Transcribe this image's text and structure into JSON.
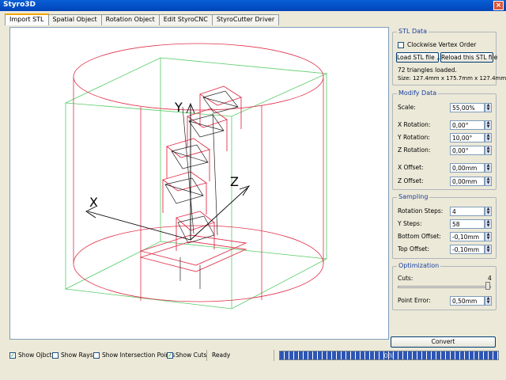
{
  "window": {
    "title": "Styro3D",
    "close_glyph": "×"
  },
  "tabs": [
    {
      "label": "Import STL",
      "active": true
    },
    {
      "label": "Spatial Object",
      "active": false
    },
    {
      "label": "Rotation Object",
      "active": false
    },
    {
      "label": "Edit StyroCNC",
      "active": false
    },
    {
      "label": "StyroCutter Driver",
      "active": false
    }
  ],
  "stl_data": {
    "title": "STL Data",
    "clockwise_label": "Clockwise Vertex Order",
    "clockwise_checked": false,
    "load_button": "Load STL file ...",
    "reload_button": "Reload this STL file",
    "triangles_text": "72 triangles loaded.",
    "size_text": "Size: 127.4mm x 175.7mm x 127.4mm"
  },
  "modify_data": {
    "title": "Modify Data",
    "scale_label": "Scale:",
    "scale_value": "55,00%",
    "xrot_label": "X Rotation:",
    "xrot_value": "0,00°",
    "yrot_label": "Y Rotation:",
    "yrot_value": "10,00°",
    "zrot_label": "Z Rotation:",
    "zrot_value": "0,00°",
    "xoff_label": "X Offset:",
    "xoff_value": "0,00mm",
    "zoff_label": "Z Offset:",
    "zoff_value": "0,00mm"
  },
  "sampling": {
    "title": "Sampling",
    "rot_steps_label": "Rotation Steps:",
    "rot_steps_value": "4",
    "ysteps_label": "Y Steps:",
    "ysteps_value": "58",
    "bottom_label": "Bottom Offset:",
    "bottom_value": "-0,10mm",
    "top_label": "Top Offset:",
    "top_value": "-0,10mm"
  },
  "optimization": {
    "title": "Optimization",
    "cuts_label": "Cuts:",
    "cuts_value": "4",
    "cuts_fraction": 1.0,
    "point_error_label": "Point Error:",
    "point_error_value": "0,50mm"
  },
  "convert_button": "Convert",
  "status": {
    "show_object": "Show Ojbct",
    "show_object_checked": true,
    "show_rays": "Show Rays",
    "show_rays_checked": false,
    "show_intersections": "Show Intersection Points",
    "show_intersections_checked": false,
    "show_cuts": "Show Cuts",
    "show_cuts_checked": true,
    "state": "Ready",
    "progress_text": "0%"
  },
  "viewport": {
    "axis_labels": {
      "y": "Y",
      "x": "X",
      "z": "Z"
    },
    "colors": {
      "model": "#e0304a",
      "box": "#55cc66",
      "axis": "#000000"
    }
  }
}
